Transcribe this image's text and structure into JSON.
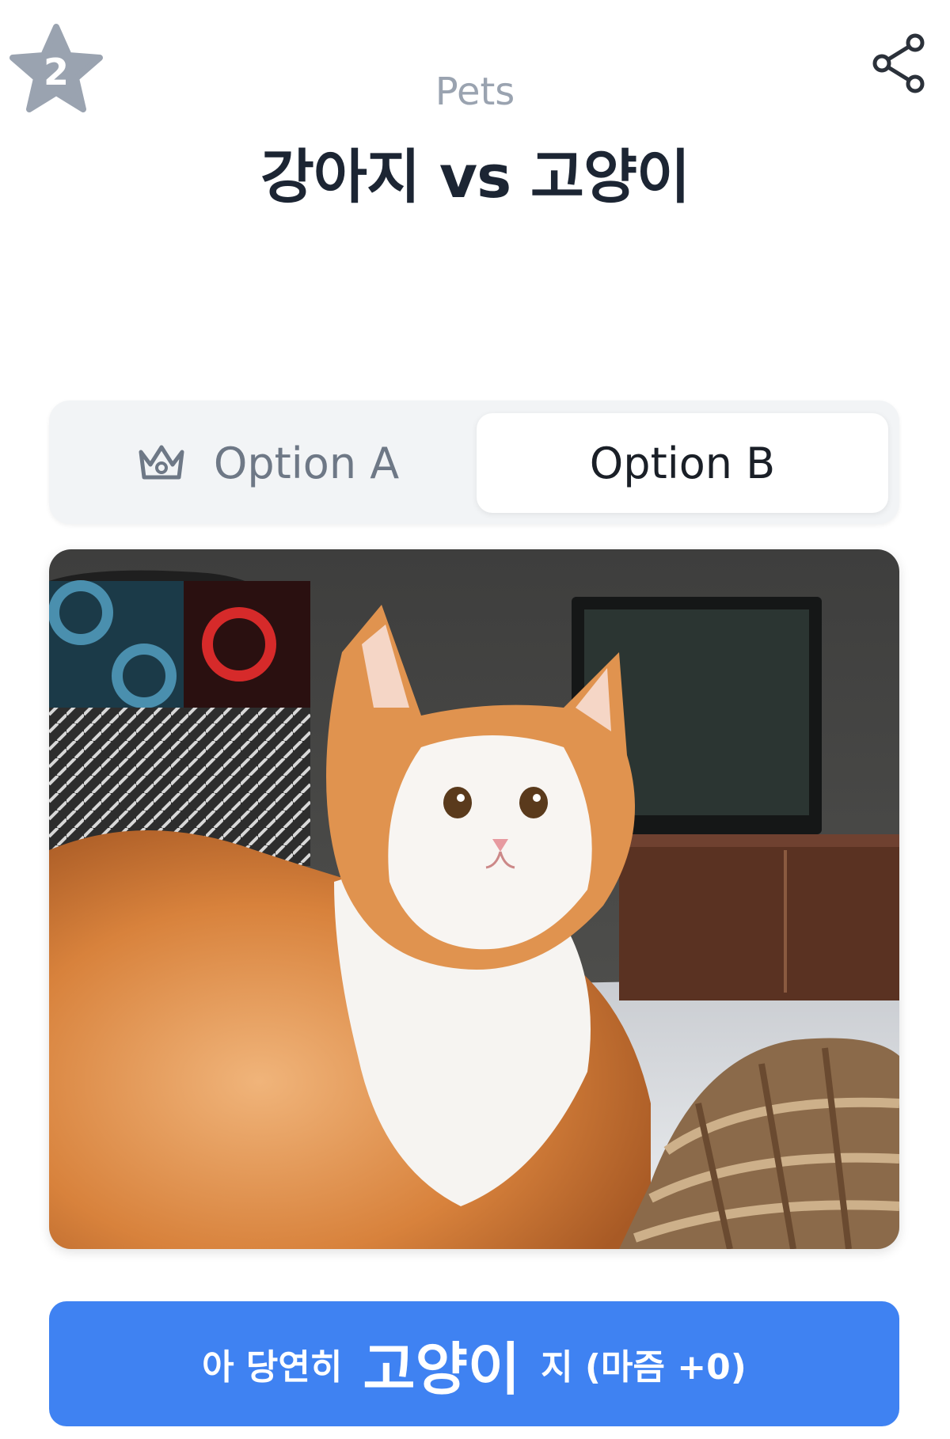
{
  "rank": {
    "number": "2",
    "icon": "star-icon",
    "color": "#9aa3b0"
  },
  "share": {
    "icon": "share-icon"
  },
  "header": {
    "category": "Pets",
    "title": "강아지 vs 고양이"
  },
  "segmented": {
    "option_a": {
      "label": "Option A",
      "icon": "crown-icon",
      "selected": false
    },
    "option_b": {
      "label": "Option B",
      "selected": true
    }
  },
  "photo": {
    "subject": "cat-photo"
  },
  "vote_button": {
    "prefix": "아 당연히",
    "choice": "고양이",
    "suffix": "지 (마즘 +0)",
    "color": "#3f82f2"
  }
}
